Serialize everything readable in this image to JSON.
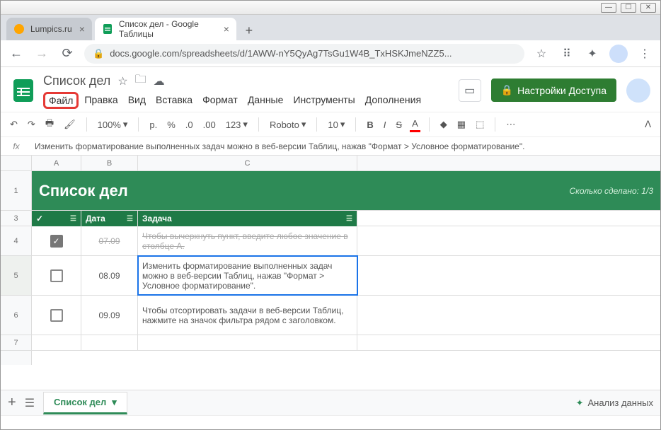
{
  "window": {
    "min": "—",
    "max": "☐",
    "close": "✕"
  },
  "tabs": [
    {
      "label": "Lumpics.ru",
      "active": false
    },
    {
      "label": "Список дел - Google Таблицы",
      "active": true
    }
  ],
  "url": "docs.google.com/spreadsheets/d/1AWW-nY5QyAg7TsGu1W4B_TxHSKJmeNZZ5...",
  "doc": {
    "title": "Список дел",
    "menus": [
      "Файл",
      "Правка",
      "Вид",
      "Вставка",
      "Формат",
      "Данные",
      "Инструменты",
      "Дополнения"
    ],
    "share": "Настройки Доступа"
  },
  "toolbar": {
    "zoom": "100%",
    "currency": "р.",
    "pct": "%",
    "dec1": ".0",
    "dec2": ".00",
    "num": "123",
    "font": "Roboto",
    "size": "10",
    "bold": "B",
    "italic": "I",
    "strike": "S",
    "color": "A"
  },
  "fx": "Изменить форматирование выполненных задач можно в веб-версии Таблиц, нажав \"Формат > Условное форматирование\".",
  "cols": [
    "A",
    "B",
    "C"
  ],
  "rows": [
    "1",
    "3",
    "4",
    "5",
    "6",
    "7"
  ],
  "sheet": {
    "title": "Список дел",
    "progress": "Сколько сделано: 1/3",
    "check": "✓",
    "date": "Дата",
    "task": "Задача",
    "r4": {
      "date": "07.09",
      "task": "Чтобы вычеркнуть пункт, введите любое значение в столбце A."
    },
    "r5": {
      "date": "08.09",
      "task": "Изменить форматирование выполненных задач можно в веб-версии Таблиц, нажав \"Формат > Условное форматирование\"."
    },
    "r6": {
      "date": "09.09",
      "task": "Чтобы отсортировать задачи в веб-версии Таблиц, нажмите на значок фильтра рядом с заголовком."
    }
  },
  "bottom": {
    "sheet": "Список дел",
    "analyze": "Анализ данных"
  }
}
